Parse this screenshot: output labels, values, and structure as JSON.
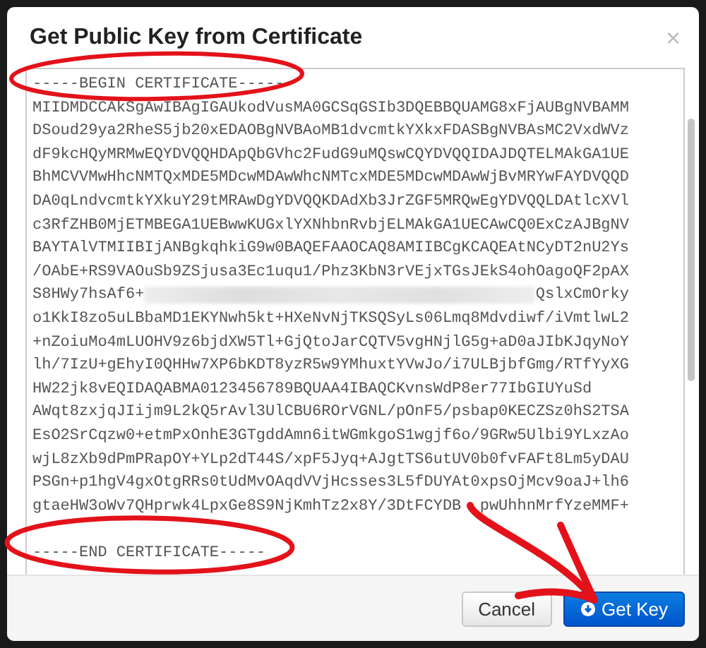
{
  "dialog": {
    "title": "Get Public Key from Certificate",
    "close": "×"
  },
  "certificate": {
    "begin": "-----BEGIN CERTIFICATE-----",
    "lines": [
      {
        "kind": "plain",
        "parts": [
          "MIIDMDCCAkSgAwIBAgIGAUkodVusMA0GCSqGSIb3DQEBBQUAMG8xFjAUBgNVBAMM"
        ]
      },
      {
        "kind": "plain",
        "parts": [
          "DSoud29ya2RheS5jb20xEDAOBgNVBAoMB1dvcmtkYXkxFDASBgNVBAsMC2VxdWVz"
        ]
      },
      {
        "kind": "plain",
        "parts": [
          "dF9kcHQyMRMwEQYDVQQHDApQbGVhc2FudG9uMQswCQYDVQQIDAJDQTELMAkGA1UE"
        ]
      },
      {
        "kind": "plain",
        "parts": [
          "BhMCVVMwHhcNMTQxMDE5MDcwMDAwWhcNMTcxMDE5MDcwMDAwWjBvMRYwFAYDVQQD"
        ]
      },
      {
        "kind": "plain",
        "parts": [
          "DA0qLndvcmtkYXkuY29tMRAwDgYDVQQKDAdXb3JrZGF5MRQwEgYDVQQLDAtlcXVl"
        ]
      },
      {
        "kind": "plain",
        "parts": [
          "c3RfZHB0MjETMBEGA1UEBwwKUGxlYXNhbnRvbjELMAkGA1UECAwCQ0ExCzAJBgNV"
        ]
      },
      {
        "kind": "plain",
        "parts": [
          "BAYTAlVTMIIBIjANBgkqhkiG9w0BAQEFAAOCAQ8AMIIBCgKCAQEAtNCyDT2nU2Ys"
        ]
      },
      {
        "kind": "plain",
        "parts": [
          "/OAbE+RS9VAOuSb9ZSjusa3Ec1uqu1/Phz3KbN3rVEjxTGsJEkS4ohOagoQF2pAX"
        ]
      },
      {
        "kind": "blurred",
        "parts": [
          "S8HWy7hsAf6+",
          "QslxCmOrky"
        ]
      },
      {
        "kind": "plain",
        "parts": [
          "o1KkI8zo5uLBbaMD1EKYNwh5kt+HXeNvNjTKSQSyLs06Lmq8Mdvdiwf/iVmtlwL2"
        ]
      },
      {
        "kind": "plain",
        "parts": [
          "+nZoiuMo4mLUOHV9z6bjdXW5Tl+GjQtoJarCQTV5vgHNjlG5g+aD0aJIbKJqyNoY"
        ]
      },
      {
        "kind": "plain",
        "parts": [
          "lh/7IzU+gEhyI0QHHw7XP6bKDT8yzR5w9YMhuxtYVwJo/i7ULBjbfGmg/RTfYyXG"
        ]
      },
      {
        "kind": "plain",
        "parts": [
          "HW22jk8vEQIDAQABMA0123456789BQUAA4IBAQCKvnsWdP8er77IbGIUYuSd"
        ]
      },
      {
        "kind": "plain",
        "parts": [
          "AWqt8zxjqJIijm9L2kQ5rAvl3UlCBU6ROrVGNL/pOnF5/psbap0KECZSz0hS2TSA"
        ]
      },
      {
        "kind": "plain",
        "parts": [
          "EsO2SrCqzw0+etmPxOnhE3GTgddAmn6itWGmkgoS1wgjf6o/9GRw5Ulbi9YLxzAo"
        ]
      },
      {
        "kind": "plain",
        "parts": [
          "wjL8zXb9dPmPRapOY+YLp2dT44S/xpF5Jyq+AJgtTS6utUV0b0fvFAFt8Lm5yDAU"
        ]
      },
      {
        "kind": "plain",
        "parts": [
          "PSGn+p1hgV4gxOtgRRs0tUdMvOAqdVVjHcsses3L5fDUYAt0xpsOjMcv9oaJ+lh6"
        ]
      },
      {
        "kind": "covered",
        "parts": [
          "gtaeHW3oWv7QHprwk4LpxGe8S9NjKmhTz2x8Y/3DtFCYDB",
          "pwUhhnMrfYzeMMF+"
        ]
      }
    ],
    "end": "-----END CERTIFICATE-----"
  },
  "buttons": [
    {
      "label": "Cancel",
      "kind": "secondary"
    },
    {
      "label": "Get Key",
      "kind": "primary"
    }
  ]
}
